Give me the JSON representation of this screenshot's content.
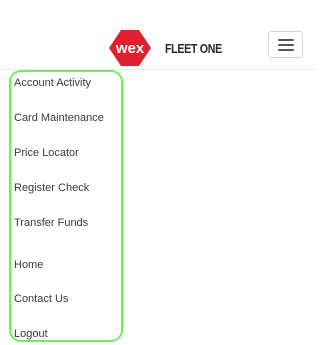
{
  "header": {
    "logo_text": "wex",
    "brand_name": "FLEET ONE",
    "logo_color": "#e0202e",
    "menu_icon": "hamburger-icon"
  },
  "menu": {
    "highlight_color": "#6cf05a",
    "items": [
      {
        "label": "Account Activity"
      },
      {
        "label": "Card Maintenance"
      },
      {
        "label": "Price Locator"
      },
      {
        "label": "Register Check"
      },
      {
        "label": "Transfer Funds"
      },
      {
        "label": "Home"
      },
      {
        "label": "Contact Us"
      },
      {
        "label": "Logout"
      }
    ]
  }
}
